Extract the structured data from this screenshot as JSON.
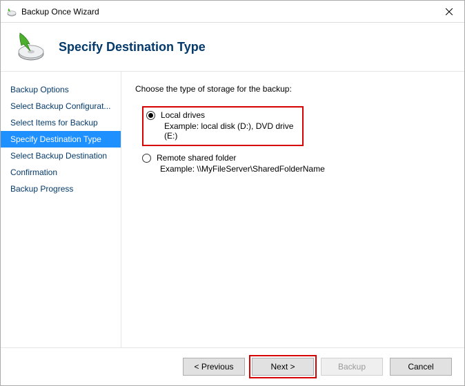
{
  "window": {
    "title": "Backup Once Wizard"
  },
  "header": {
    "title": "Specify Destination Type"
  },
  "sidebar": {
    "items": [
      {
        "label": "Backup Options",
        "selected": false
      },
      {
        "label": "Select Backup Configurat...",
        "selected": false
      },
      {
        "label": "Select Items for Backup",
        "selected": false
      },
      {
        "label": "Specify Destination Type",
        "selected": true
      },
      {
        "label": "Select Backup Destination",
        "selected": false
      },
      {
        "label": "Confirmation",
        "selected": false
      },
      {
        "label": "Backup Progress",
        "selected": false
      }
    ]
  },
  "content": {
    "prompt": "Choose the type of storage for the backup:",
    "options": [
      {
        "label": "Local drives",
        "example": "Example: local disk (D:), DVD drive (E:)",
        "checked": true,
        "highlighted": true
      },
      {
        "label": "Remote shared folder",
        "example": "Example: \\\\MyFileServer\\SharedFolderName",
        "checked": false,
        "highlighted": false
      }
    ]
  },
  "footer": {
    "previous": "< Previous",
    "next": "Next >",
    "backup": "Backup",
    "cancel": "Cancel"
  }
}
